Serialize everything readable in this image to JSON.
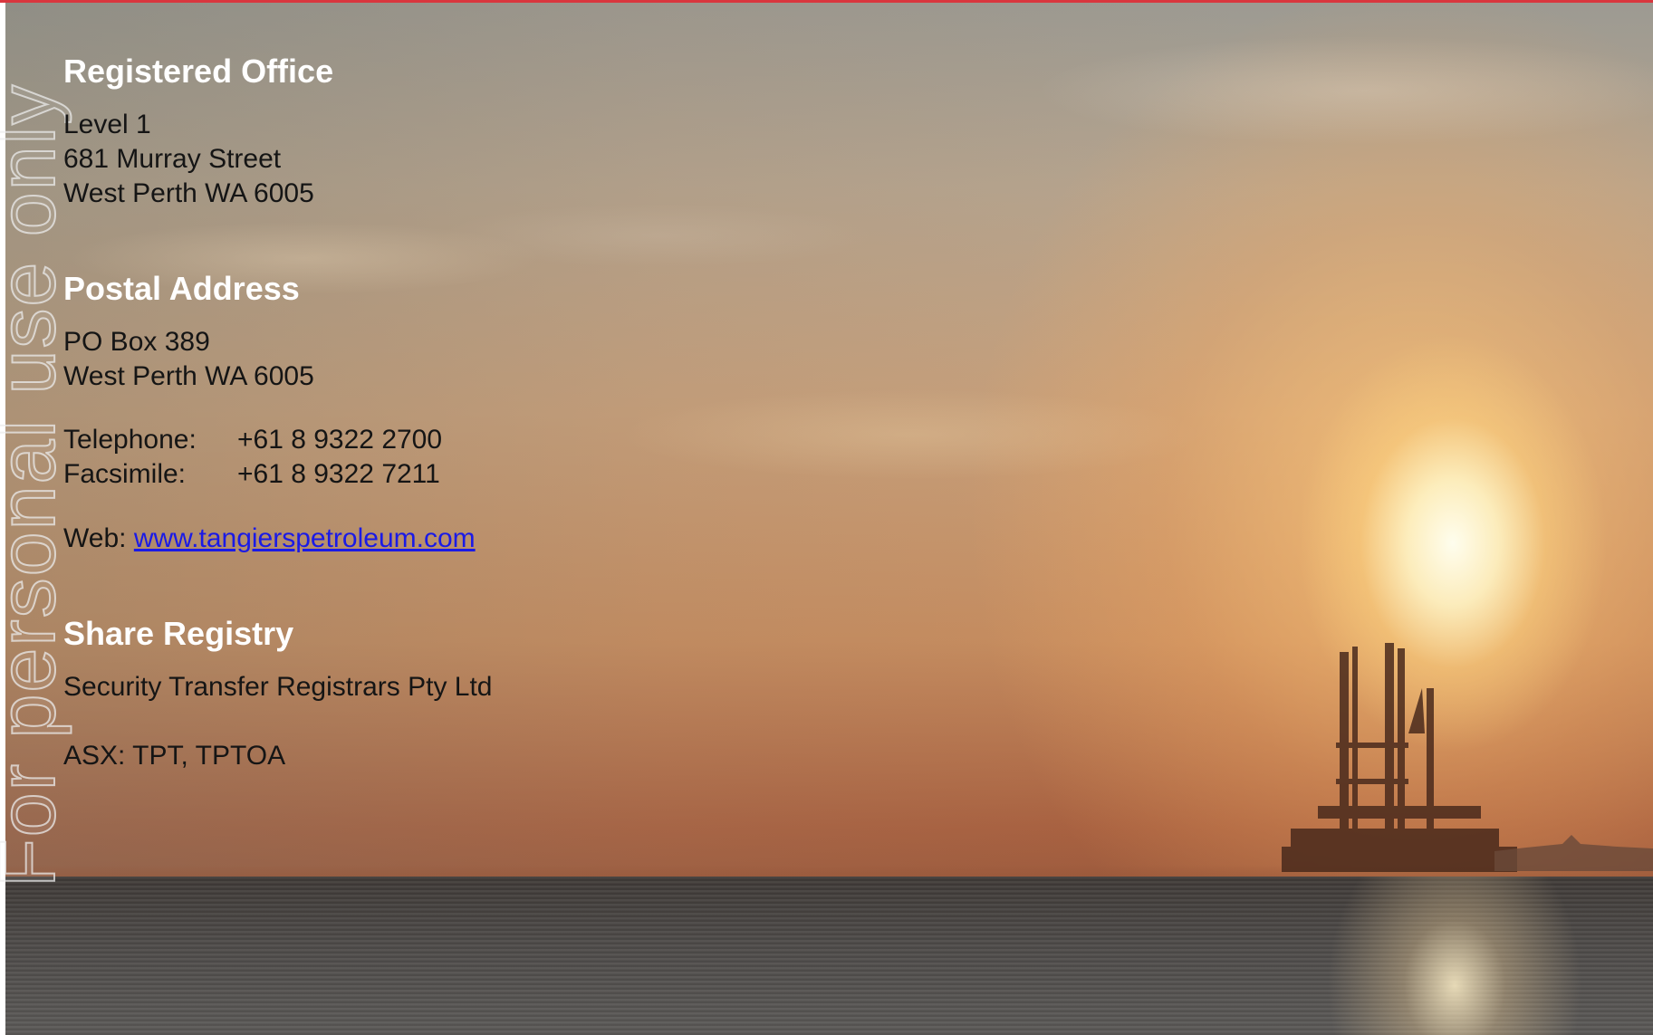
{
  "watermark": {
    "text": "For personal use only"
  },
  "registered_office": {
    "heading": "Registered Office",
    "lines": [
      "Level 1",
      "681 Murray Street",
      "West Perth WA 6005"
    ]
  },
  "postal_address": {
    "heading": "Postal Address",
    "lines": [
      "PO Box 389",
      "West Perth WA 6005"
    ]
  },
  "contact": {
    "telephone_label": "Telephone:",
    "telephone_value": "+61 8 9322 2700",
    "facsimile_label": "Facsimile:",
    "facsimile_value": "+61 8 9322 7211",
    "web_label": "Web:",
    "web_link": "www.tangierspetroleum.com"
  },
  "share_registry": {
    "heading": "Share Registry",
    "name": "Security Transfer Registrars Pty Ltd",
    "asx": "ASX: TPT, TPTOA"
  },
  "colors": {
    "accent_line": "#d9363e",
    "heading_text": "#ffffff",
    "body_text": "#151515",
    "link": "#1a1ae6"
  }
}
